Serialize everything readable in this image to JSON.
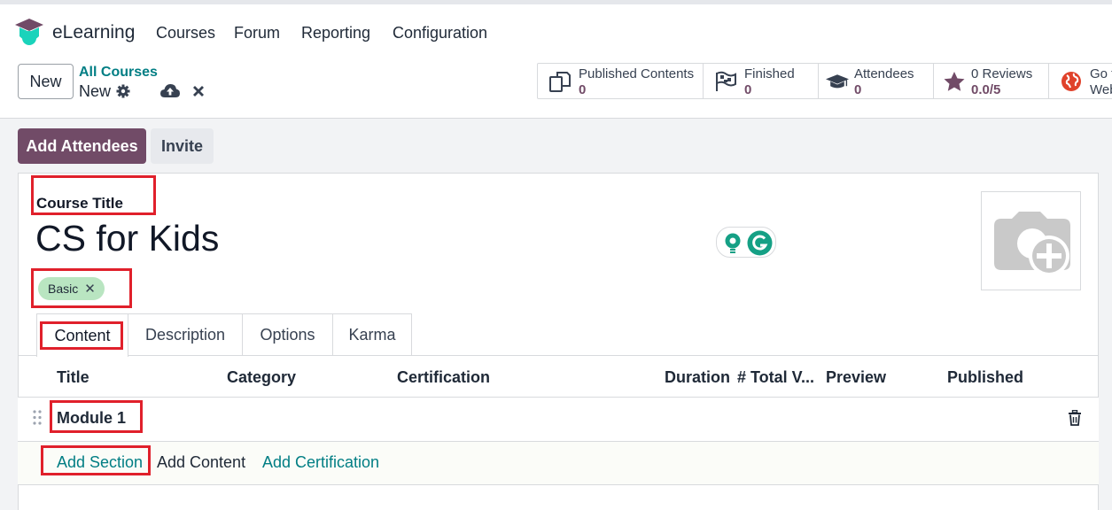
{
  "nav": {
    "app_name": "eLearning",
    "menus": [
      "Courses",
      "Forum",
      "Reporting",
      "Configuration"
    ]
  },
  "control_panel": {
    "new_label": "New",
    "breadcrumb_parent": "All Courses",
    "breadcrumb_current": "New"
  },
  "stats": [
    {
      "label": "Published Contents",
      "value": "0",
      "icon": "documents-icon"
    },
    {
      "label": "Finished",
      "value": "0",
      "icon": "checkered-flag-icon"
    },
    {
      "label": "Attendees",
      "value": "0",
      "icon": "graduation-cap-icon"
    },
    {
      "label": "0 Reviews",
      "value": "0.0/5",
      "icon": "star-icon"
    },
    {
      "label": "Go to",
      "value": "Website",
      "icon": "globe-icon"
    }
  ],
  "actions": {
    "add_attendees": "Add Attendees",
    "invite": "Invite"
  },
  "form": {
    "title_label": "Course Title",
    "course_name": "CS for Kids",
    "tag": "Basic"
  },
  "tabs": [
    "Content",
    "Description",
    "Options",
    "Karma"
  ],
  "columns": [
    "Title",
    "Category",
    "Certification",
    "Duration",
    "# Total V...",
    "Preview",
    "Published"
  ],
  "sections": [
    {
      "name": "Module 1"
    }
  ],
  "add_links": [
    "Add Section",
    "Add Content",
    "Add Certification"
  ],
  "colors": {
    "brand": "#714b67",
    "link": "#017e84",
    "highlight": "#e0202b",
    "tag_bg": "#b9e5c1"
  }
}
